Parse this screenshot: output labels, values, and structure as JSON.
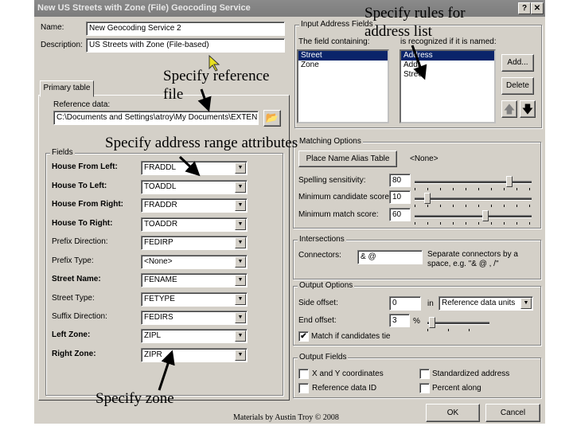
{
  "window": {
    "title": "New US Streets with Zone (File) Geocoding Service",
    "help": "?",
    "close": "✕"
  },
  "general": {
    "name_label": "Name:",
    "name_value": "New Geocoding Service 2",
    "description_label": "Description:",
    "description_value": "US Streets with Zone (File-based)"
  },
  "tab": {
    "label": "Primary table",
    "reference_label": "Reference data:",
    "reference_value": "C:\\Documents and Settings\\atroy\\My Documents\\EXTEN"
  },
  "fields": {
    "legend": "Fields",
    "rows": [
      {
        "label": "House From Left:",
        "value": "FRADDL",
        "bold": true
      },
      {
        "label": "House To Left:",
        "value": "TOADDL",
        "bold": true
      },
      {
        "label": "House From Right:",
        "value": "FRADDR",
        "bold": true
      },
      {
        "label": "House To Right:",
        "value": "TOADDR",
        "bold": true
      },
      {
        "label": "Prefix Direction:",
        "value": "FEDIRP",
        "bold": false
      },
      {
        "label": "Prefix Type:",
        "value": "<None>",
        "bold": false
      },
      {
        "label": "Street Name:",
        "value": "FENAME",
        "bold": true
      },
      {
        "label": "Street Type:",
        "value": "FETYPE",
        "bold": false
      },
      {
        "label": "Suffix Direction:",
        "value": "FEDIRS",
        "bold": false
      },
      {
        "label": "Left Zone:",
        "value": "ZIPL",
        "bold": true
      },
      {
        "label": "Right Zone:",
        "value": "ZIPR",
        "bold": true
      }
    ]
  },
  "address_fields": {
    "legend": "Input Address Fields",
    "col1": "The field containing:",
    "col2": "is recognized if it is named:",
    "fields": [
      "Street",
      "Zone"
    ],
    "names": [
      "Address",
      "Addr",
      "Street"
    ],
    "add": "Add...",
    "delete": "Delete"
  },
  "matching": {
    "legend": "Matching Options",
    "alias_button": "Place Name Alias Table",
    "alias_value": "<None>",
    "spelling_label": "Spelling sensitivity:",
    "spelling_value": "80",
    "spelling": 80,
    "candidate_label": "Minimum candidate score:",
    "candidate_value": "10",
    "candidate": 10,
    "match_label": "Minimum match score:",
    "match_value": "60",
    "match": 60
  },
  "intersections": {
    "legend": "Intersections",
    "connectors_label": "Connectors:",
    "connectors_value": "& @",
    "help": "Separate connectors by a space, e.g. \"& @ , /\""
  },
  "output_options": {
    "legend": "Output Options",
    "side_label": "Side offset:",
    "side_value": "0",
    "in": "in",
    "units": "Reference data units",
    "end_label": "End offset:",
    "end_value": "3",
    "percent": "%",
    "end_fraction": 0.06,
    "tie_label": "Match if candidates tie",
    "tie_checked": true
  },
  "output_fields": {
    "legend": "Output Fields",
    "xy": "X and Y coordinates",
    "refid": "Reference data ID",
    "std": "Standardized address",
    "pct": "Percent along"
  },
  "buttons": {
    "ok": "OK",
    "cancel": "Cancel"
  },
  "footer": "Materials by Austin Troy © 2008",
  "annotations": {
    "rules1": "Specify rules for",
    "rules2": "address list",
    "ref1": "Specify reference",
    "ref2": "file",
    "range": "Specify address range attributes",
    "zone": "Specify zone"
  }
}
